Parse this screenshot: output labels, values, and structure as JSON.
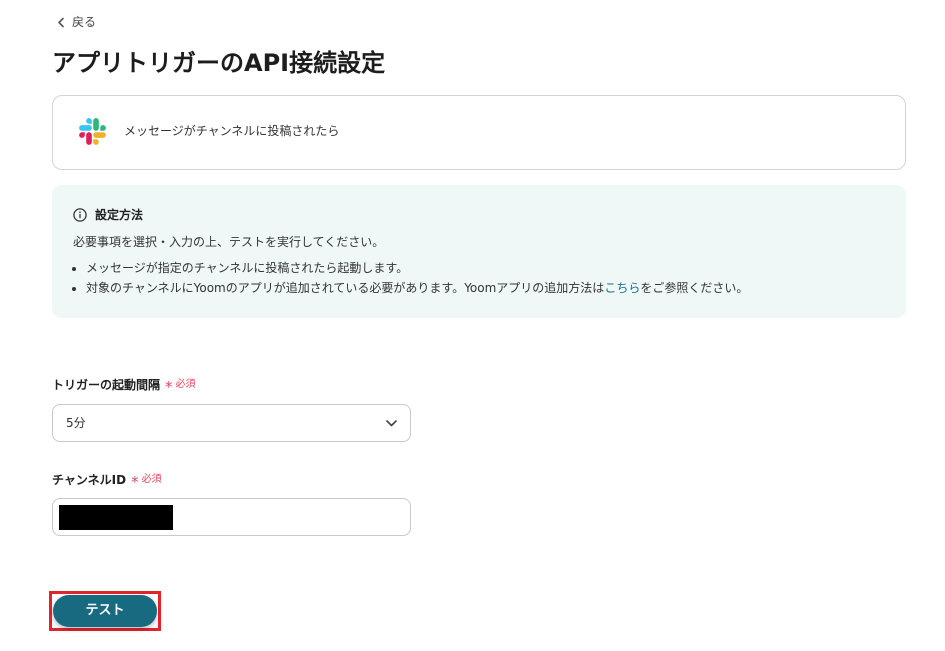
{
  "nav": {
    "back_icon": "chevron-left-icon",
    "back_label": "戻る"
  },
  "page": {
    "title": "アプリトリガーのAPI接続設定"
  },
  "trigger": {
    "app_icon": "slack-icon",
    "label": "メッセージがチャンネルに投稿されたら"
  },
  "info": {
    "icon": "info-icon",
    "heading": "設定方法",
    "description": "必要事項を選択・入力の上、テストを実行してください。",
    "bullets": [
      {
        "text": "メッセージが指定のチャンネルに投稿されたら起動します。"
      },
      {
        "text_before": "対象のチャンネルにYoomのアプリが追加されている必要があります。Yoomアプリの追加方法は",
        "link_label": "こちら",
        "text_after": "をご参照ください。"
      }
    ]
  },
  "form": {
    "interval": {
      "label": "トリガーの起動間隔",
      "required_mark": "*",
      "required_label": "必須",
      "value": "5分",
      "dropdown_icon": "chevron-down-icon"
    },
    "channel_id": {
      "label": "チャンネルID",
      "required_mark": "*",
      "required_label": "必須"
    }
  },
  "actions": {
    "test_label": "テスト"
  },
  "colors": {
    "accent": "#176a80",
    "link": "#1a6b86",
    "required": "#e8445c",
    "info_bg": "#eff8f7",
    "highlight": "#e2252b",
    "border": "#d4d4d4",
    "text": "#222222"
  }
}
